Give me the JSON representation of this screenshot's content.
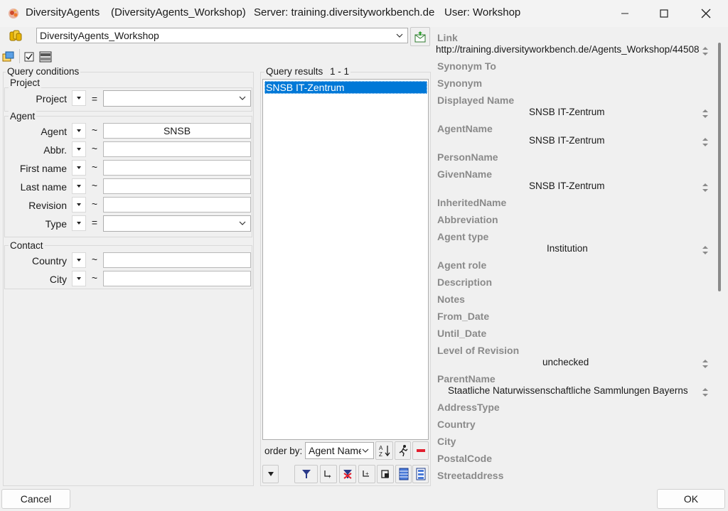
{
  "window": {
    "app_name": "DiversityAgents",
    "database_title": "(DiversityAgents_Workshop)",
    "server": "Server: training.diversityworkbench.de",
    "user": "User: Workshop"
  },
  "database_combo": {
    "value": "DiversityAgents_Workshop"
  },
  "query_conditions": {
    "title": "Query conditions",
    "project_group": {
      "title": "Project",
      "rows": [
        {
          "label": "Project",
          "operator": "=",
          "value": ""
        }
      ]
    },
    "agent_group": {
      "title": "Agent",
      "rows": [
        {
          "label": "Agent",
          "operator": "~",
          "value": "SNSB"
        },
        {
          "label": "Abbr.",
          "operator": "~",
          "value": ""
        },
        {
          "label": "First name",
          "operator": "~",
          "value": ""
        },
        {
          "label": "Last name",
          "operator": "~",
          "value": ""
        },
        {
          "label": "Revision",
          "operator": "~",
          "value": ""
        },
        {
          "label": "Type",
          "operator": "=",
          "value": ""
        }
      ]
    },
    "contact_group": {
      "title": "Contact",
      "rows": [
        {
          "label": "Country",
          "operator": "~",
          "value": ""
        },
        {
          "label": "City",
          "operator": "~",
          "value": ""
        }
      ]
    }
  },
  "query_results": {
    "title": "Query results",
    "range": "1 - 1",
    "items": [
      "SNSB IT-Zentrum"
    ],
    "order_by_label": "order by:",
    "order_by_value": "Agent Name"
  },
  "details": {
    "link": {
      "label": "Link",
      "value": "http://training.diversityworkbench.de/Agents_Workshop/44508"
    },
    "synonym_to": "Synonym To",
    "synonym": "Synonym",
    "displayed_name": {
      "label": "Displayed Name",
      "value": "SNSB IT-Zentrum"
    },
    "agent_name": {
      "label": "AgentName",
      "value": "SNSB IT-Zentrum"
    },
    "person_name": "PersonName",
    "given_name": {
      "label": "GivenName",
      "value": "SNSB IT-Zentrum"
    },
    "inherited_name": "InheritedName",
    "abbreviation": "Abbreviation",
    "agent_type": {
      "label": "Agent type",
      "value": "Institution"
    },
    "agent_role": "Agent role",
    "description": "Description",
    "notes": "Notes",
    "from_date": "From_Date",
    "until_date": "Until_Date",
    "level_of_revision": {
      "label": "Level of Revision",
      "value": "unchecked"
    },
    "parent_name": {
      "label": "ParentName",
      "value": "Staatliche Naturwissenschaftliche Sammlungen Bayerns"
    },
    "address_type": "AddressType",
    "country": "Country",
    "city": "City",
    "postal_code": "PostalCode",
    "street_address": "Streetaddress"
  },
  "buttons": {
    "cancel": "Cancel",
    "ok": "OK"
  },
  "colors": {
    "selection": "#0078d7",
    "label_gray": "#8a8a8a"
  }
}
